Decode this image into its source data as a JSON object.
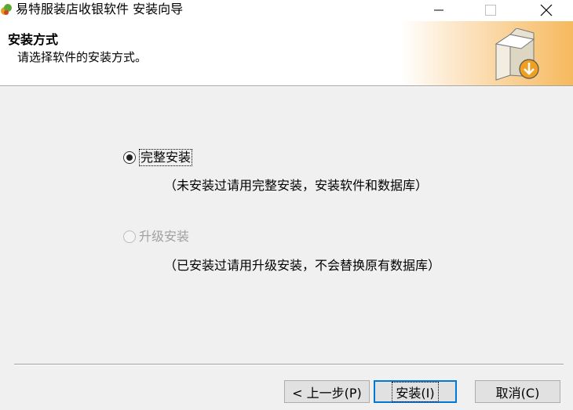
{
  "window": {
    "title": "易特服装店收银软件 安装向导",
    "controls": [
      "minimize",
      "maximize",
      "close"
    ]
  },
  "header": {
    "title": "安装方式",
    "subtitle": "请选择软件的安装方式。",
    "icon": "installer-box-icon"
  },
  "options": [
    {
      "label": "完整安装",
      "description": "（未安装过请用完整安装，安装软件和数据库）",
      "checked": true,
      "enabled": true
    },
    {
      "label": "升级安装",
      "description": "（已安装过请用升级安装，不会替换原有数据库）",
      "checked": false,
      "enabled": false
    }
  ],
  "buttons": {
    "back": "< 上一步(P)",
    "install": "安装(I)",
    "cancel": "取消(C)"
  },
  "colors": {
    "header_gradient_end": "#f6b95e",
    "main_background": "#f0f0f0",
    "default_button_border": "#0078d7",
    "disabled_text": "#a0a0a0"
  }
}
